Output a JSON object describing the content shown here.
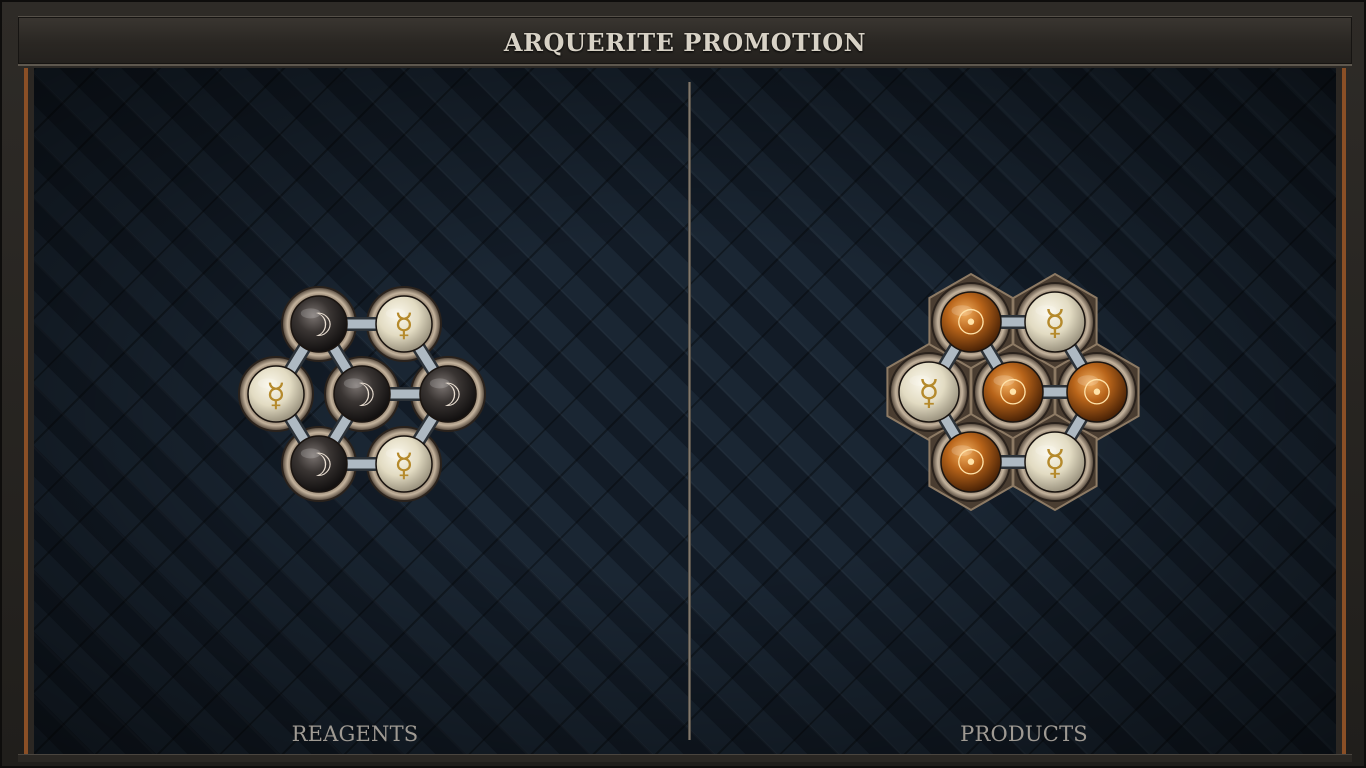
{
  "title": "ARQUERITE PROMOTION",
  "panels": {
    "reagents": {
      "label": "REAGENTS",
      "atoms": [
        {
          "element": "silver",
          "symbol": "☽"
        },
        {
          "element": "quicksilver",
          "symbol": "☿"
        },
        {
          "element": "quicksilver",
          "symbol": "☿"
        },
        {
          "element": "silver",
          "symbol": "☽"
        },
        {
          "element": "silver",
          "symbol": "☽"
        },
        {
          "element": "silver",
          "symbol": "☽"
        },
        {
          "element": "quicksilver",
          "symbol": "☿"
        }
      ]
    },
    "products": {
      "label": "PRODUCTS",
      "atoms": [
        {
          "element": "gold",
          "symbol": "☉"
        },
        {
          "element": "quicksilver",
          "symbol": "☿"
        },
        {
          "element": "quicksilver",
          "symbol": "☿"
        },
        {
          "element": "gold",
          "symbol": "☉"
        },
        {
          "element": "gold",
          "symbol": "☉"
        },
        {
          "element": "gold",
          "symbol": "☉"
        },
        {
          "element": "quicksilver",
          "symbol": "☿"
        }
      ]
    }
  },
  "colors": {
    "silver_orb": "#3a3533",
    "quicksilver_orb": "#e7e1cb",
    "gold_orb": "#b8641a",
    "bond": "#a9b4bd",
    "frame_copper": "#8a4f26"
  }
}
